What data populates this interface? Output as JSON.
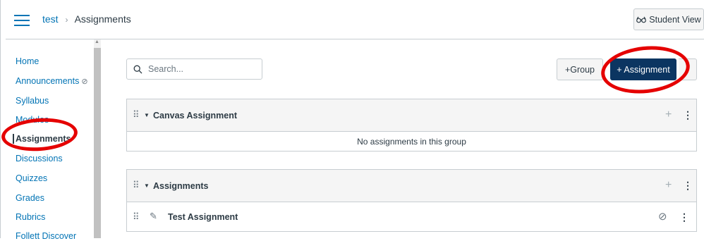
{
  "header": {
    "menu_icon": "hamburger-icon",
    "breadcrumb_course": "test",
    "breadcrumb_separator": "›",
    "breadcrumb_current": "Assignments",
    "student_view_icon": "glasses-icon",
    "student_view_label": "Student View"
  },
  "sidebar": {
    "items": [
      {
        "label": "Home"
      },
      {
        "label": "Announcements"
      },
      {
        "label": "Syllabus"
      },
      {
        "label": "Modules"
      },
      {
        "label": "Assignments"
      },
      {
        "label": "Discussions"
      },
      {
        "label": "Quizzes"
      },
      {
        "label": "Grades"
      },
      {
        "label": "Rubrics"
      },
      {
        "label": "Follett Discover"
      }
    ],
    "active_label": "Assignments",
    "hidden_icon": "eye-slash-icon"
  },
  "toolbar": {
    "search_placeholder": "Search...",
    "search_icon": "search-icon",
    "group_button": "+Group",
    "assignment_button": "+ Assignment",
    "more_icon": "kebab-icon"
  },
  "groups": [
    {
      "title": "Canvas Assignment",
      "empty_message": "No assignments in this group",
      "assignments": []
    },
    {
      "title": "Assignments",
      "empty_message": "",
      "assignments": [
        {
          "title": "Test Assignment",
          "icon": "assignment-icon",
          "status_icon": "unpublished-icon"
        }
      ]
    }
  ],
  "colors": {
    "link": "#0374b5",
    "primary_button": "#0b3561",
    "annotation": "#e50000"
  }
}
